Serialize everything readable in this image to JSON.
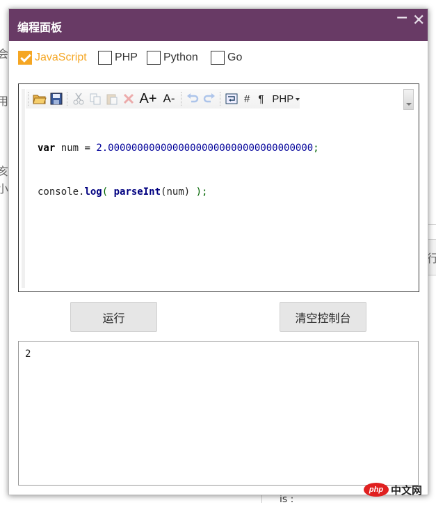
{
  "background": {
    "fragments": [
      "会",
      "用",
      "亥",
      "小",
      "行",
      "is :"
    ]
  },
  "dialog": {
    "title": "编程面板",
    "minimize_glyph": "−",
    "close_glyph": "✕",
    "title_bar_color": "#683a65"
  },
  "languages": [
    {
      "label": "JavaScript",
      "checked": true
    },
    {
      "label": "PHP",
      "checked": false
    },
    {
      "label": "Python",
      "checked": false
    },
    {
      "label": "Go",
      "checked": false
    }
  ],
  "editor": {
    "toolbar": {
      "icons": [
        "open-icon",
        "save-icon",
        "cut-icon",
        "copy-icon",
        "paste-icon",
        "delete-icon",
        "font-increase-icon",
        "font-decrease-icon",
        "undo-icon",
        "redo-icon",
        "wrap-icon"
      ],
      "font_increase_label": "A+",
      "font_decrease_label": "A-",
      "line_numbers_label": "#",
      "pilcrow_label": "¶",
      "language_select": "PHP"
    },
    "code_lines": [
      {
        "kw": "var",
        "mid": " num = ",
        "num": "2.00000000000000000000000000000000000",
        "end": ";"
      },
      {
        "pre": "console.",
        "fn": "log",
        "op1": "( ",
        "fn2": "parseInt",
        "args": "(num) ",
        "op2": ");"
      }
    ]
  },
  "buttons": {
    "run": "运行",
    "clear_console": "清空控制台"
  },
  "console": {
    "output": "2"
  },
  "watermark": {
    "logo": "php",
    "text": "中文网"
  },
  "colors": {
    "accent": "#f5a623",
    "brand": "#683a65"
  }
}
